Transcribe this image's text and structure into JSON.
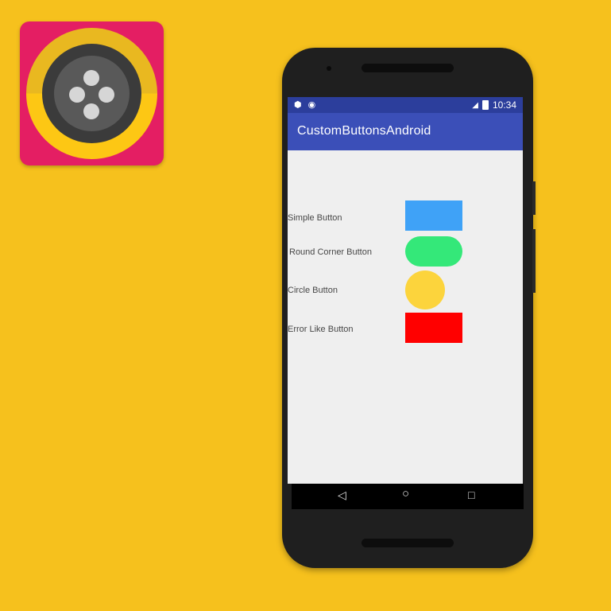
{
  "status_bar": {
    "left_icons": [
      "package-icon",
      "chat-icon"
    ],
    "signal_icon": "signal-icon",
    "battery_icon": "battery-icon",
    "time": "10:34"
  },
  "app_bar": {
    "title": "CustomButtonsAndroid"
  },
  "rows": [
    {
      "label": "Simple Button",
      "button_color": "#3fa2f7"
    },
    {
      "label": "Round Corner Button",
      "button_color": "#34e879"
    },
    {
      "label": "Circle Button",
      "button_color": "#fcd43c"
    },
    {
      "label": "Error Like Button",
      "button_color": "#ff0000"
    }
  ],
  "nav_bar": {
    "back_icon": "back-icon",
    "home_icon": "home-icon",
    "recents_icon": "recents-icon"
  },
  "colors": {
    "background": "#f6c11d",
    "status_bar": "#2c3e9c",
    "app_bar": "#3b4fb8",
    "app_icon_accent": "#e41e63"
  }
}
